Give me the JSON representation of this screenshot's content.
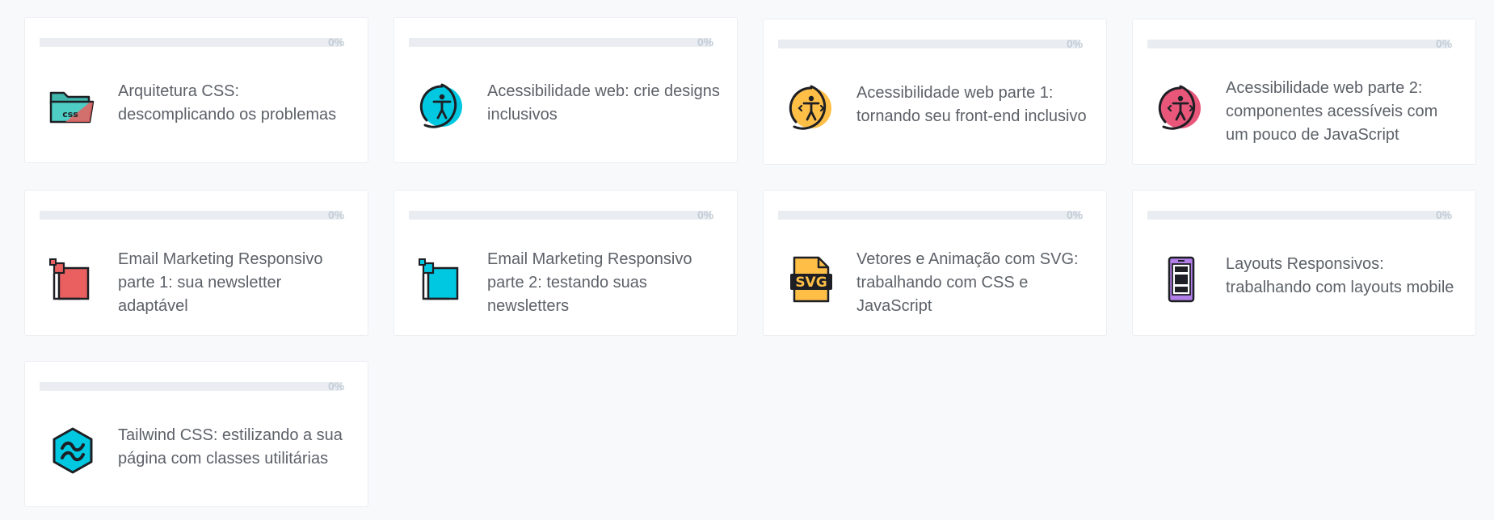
{
  "courses": [
    {
      "title": "Arquitetura CSS: descomplicando os problemas",
      "progress": "0%",
      "icon": "folder-css-icon",
      "color": "#4ecdc4"
    },
    {
      "title": "Acessibilidade web: crie designs inclusivos",
      "progress": "0%",
      "icon": "accessibility-icon",
      "color": "#00c8e0"
    },
    {
      "title": "Acessibilidade web parte 1: tornando seu front-end inclusivo",
      "progress": "0%",
      "icon": "accessibility-icon",
      "color": "#ffbf47"
    },
    {
      "title": "Acessibilidade web parte 2: componentes acessíveis com um pouco de JavaScript",
      "progress": "0%",
      "icon": "accessibility-icon",
      "color": "#e8567a"
    },
    {
      "title": "Email Marketing Responsivo parte 1: sua newsletter adaptável",
      "progress": "0%",
      "icon": "responsive-email-icon",
      "color": "#ea5f5f"
    },
    {
      "title": "Email Marketing Responsivo parte 2: testando suas newsletters",
      "progress": "0%",
      "icon": "responsive-email-icon",
      "color": "#00c8e0"
    },
    {
      "title": "Vetores e Animação com SVG: trabalhando com CSS e JavaScript",
      "progress": "0%",
      "icon": "svg-file-icon",
      "color": "#ffbf47"
    },
    {
      "title": "Layouts Responsivos: trabalhando com layouts mobile",
      "progress": "0%",
      "icon": "mobile-phone-icon",
      "color": "#b27ee8"
    },
    {
      "title": "Tailwind CSS: estilizando a sua página com classes utilitárias",
      "progress": "0%",
      "icon": "tailwind-logo-icon",
      "color": "#00c8e0"
    }
  ]
}
